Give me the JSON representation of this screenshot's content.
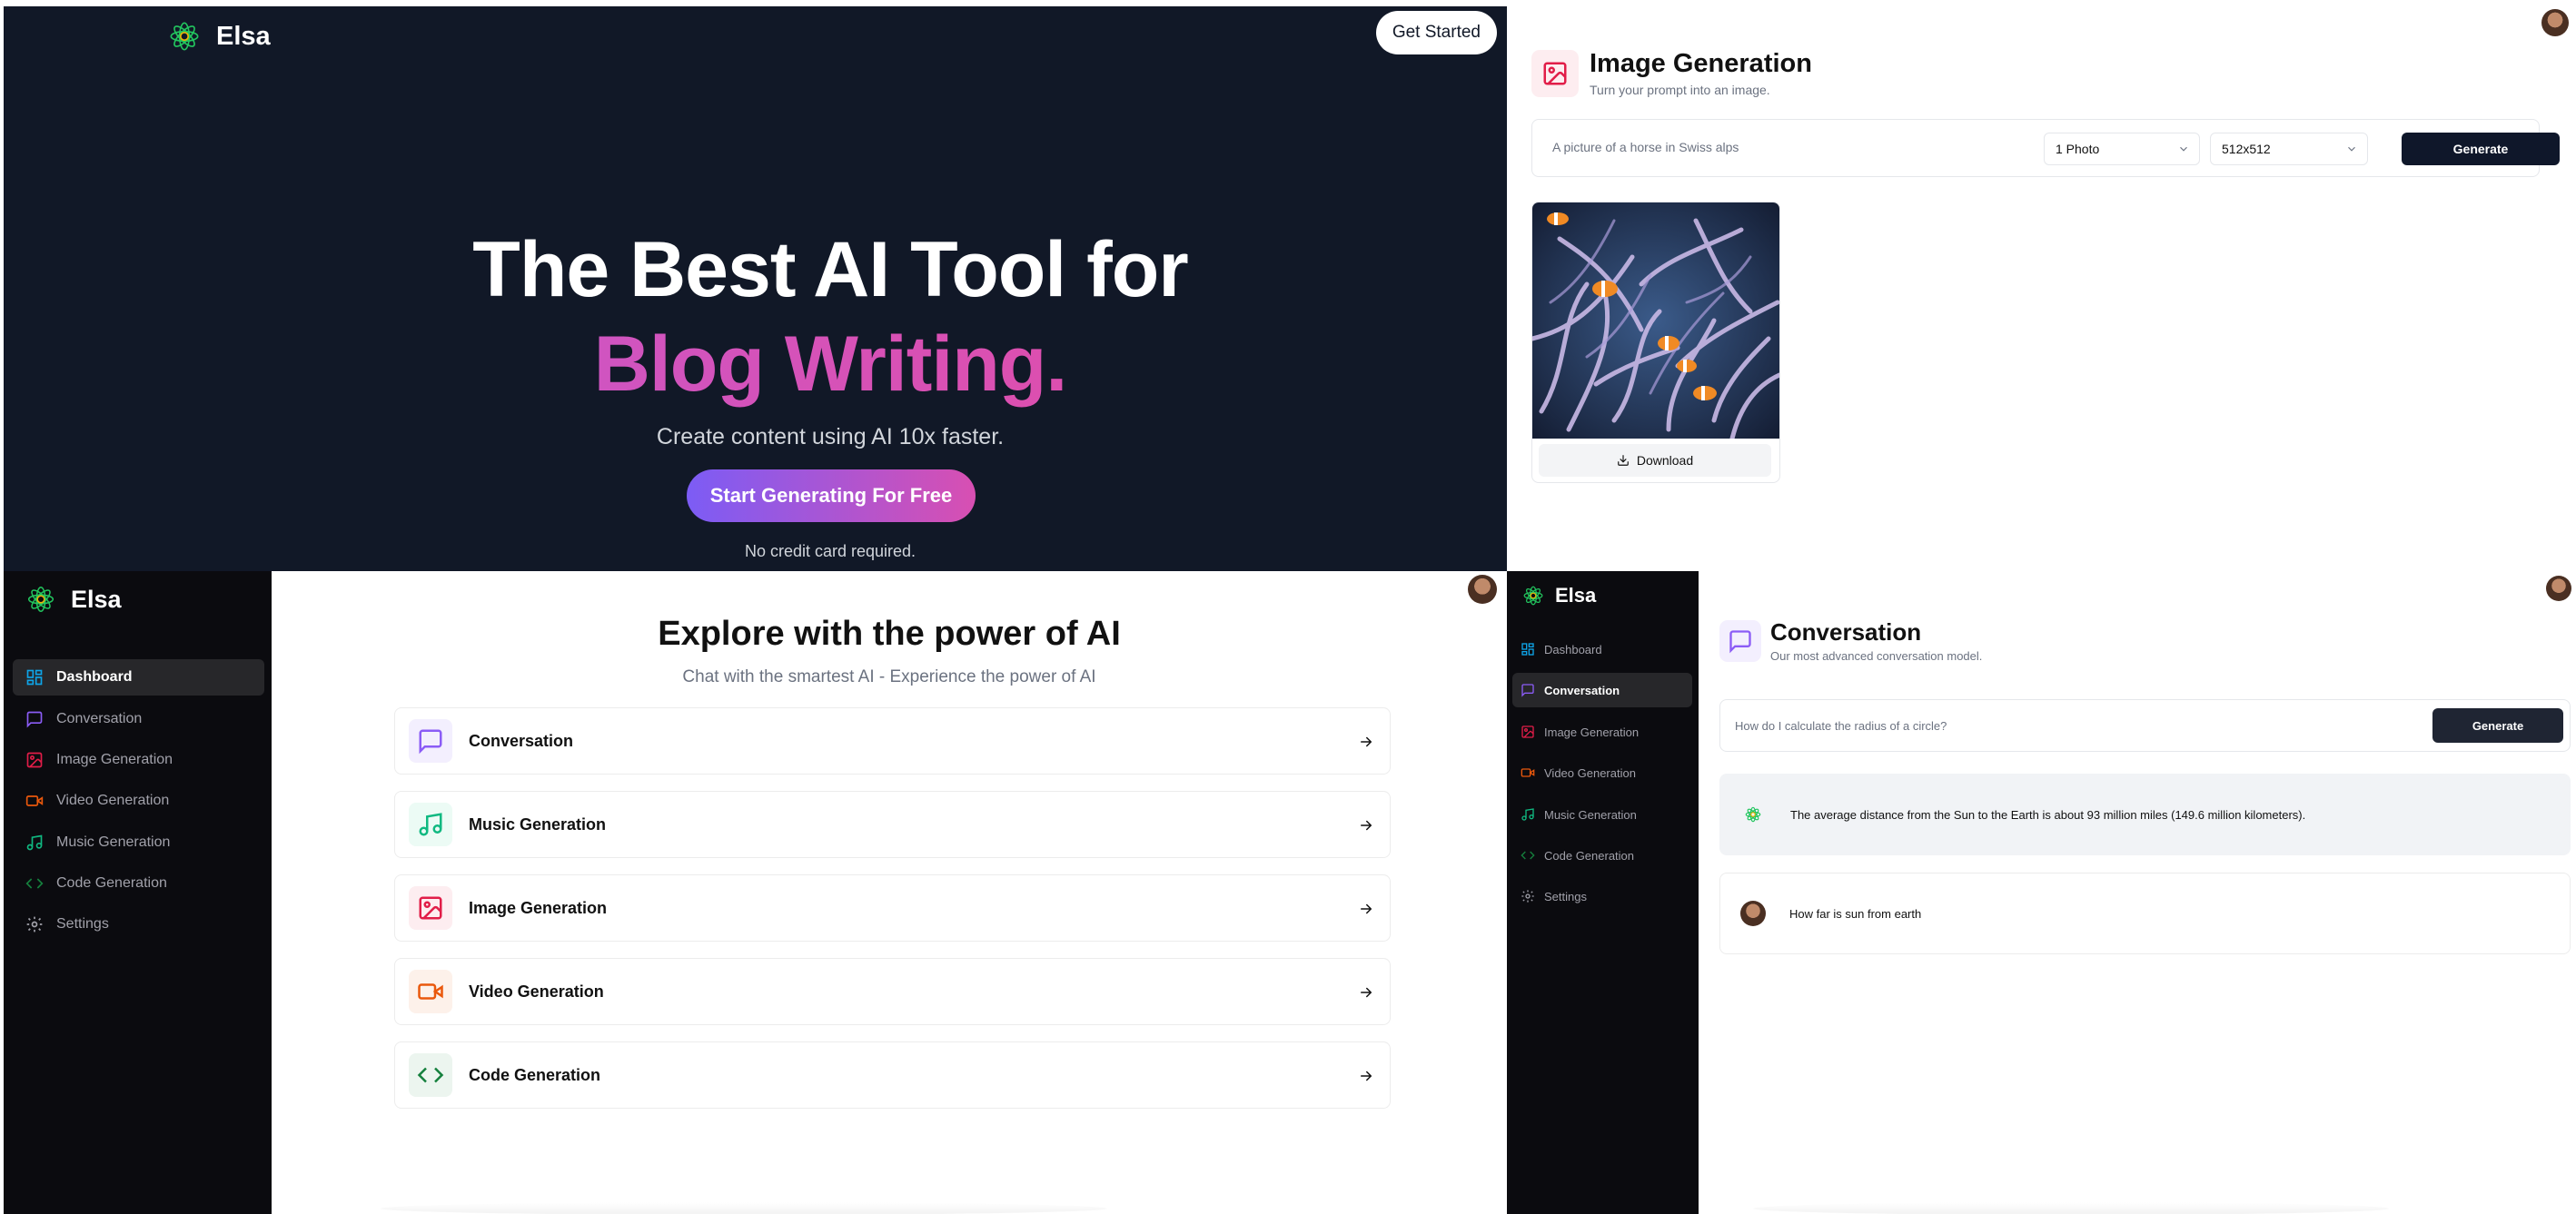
{
  "landing": {
    "brand_name": "Elsa",
    "get_started_label": "Get Started",
    "headline_line1": "The Best AI Tool for",
    "headline_line2": "Blog Writing.",
    "subheadline": "Create content using AI 10x faster.",
    "cta_label": "Start Generating For Free",
    "note": "No credit card required."
  },
  "image_generation": {
    "title": "Image Generation",
    "description": "Turn your prompt into an image.",
    "prompt_value": "A picture of a horse in Swiss alps",
    "amount_selected": "1 Photo",
    "resolution_selected": "512x512",
    "generate_label": "Generate",
    "download_label": "Download"
  },
  "sidebar": {
    "brand_name": "Elsa",
    "items": [
      {
        "label": "Dashboard",
        "icon": "layout-dashboard-icon",
        "color": "#0ea5e9"
      },
      {
        "label": "Conversation",
        "icon": "message-square-icon",
        "color": "#8b5cf6"
      },
      {
        "label": "Image Generation",
        "icon": "image-icon",
        "color": "#e11d48"
      },
      {
        "label": "Video Generation",
        "icon": "video-icon",
        "color": "#ea580c"
      },
      {
        "label": "Music Generation",
        "icon": "music-icon",
        "color": "#10b981"
      },
      {
        "label": "Code Generation",
        "icon": "code-icon",
        "color": "#15803d"
      },
      {
        "label": "Settings",
        "icon": "settings-icon",
        "color": "#a1a1aa"
      }
    ]
  },
  "dashboard": {
    "title": "Explore with the power of AI",
    "subtitle": "Chat with the smartest AI - Experience the power of AI",
    "tools": [
      {
        "label": "Conversation",
        "icon": "message-square-icon",
        "color": "#8b5cf6",
        "bg": "#f3effe"
      },
      {
        "label": "Music Generation",
        "icon": "music-icon",
        "color": "#10b981",
        "bg": "#ecfbf5"
      },
      {
        "label": "Image Generation",
        "icon": "image-icon",
        "color": "#e11d48",
        "bg": "#fdedf0"
      },
      {
        "label": "Video Generation",
        "icon": "video-icon",
        "color": "#ea580c",
        "bg": "#fdf1ea"
      },
      {
        "label": "Code Generation",
        "icon": "code-icon",
        "color": "#15803d",
        "bg": "#ecf5ef"
      }
    ]
  },
  "conversation": {
    "title": "Conversation",
    "description": "Our most advanced conversation model.",
    "prompt_placeholder": "How do I calculate the radius of a circle?",
    "generate_label": "Generate",
    "messages": [
      {
        "role": "assistant",
        "text": "The average distance from the Sun to the Earth is about 93 million miles (149.6 million kilometers)."
      },
      {
        "role": "user",
        "text": "How far is sun from earth"
      }
    ]
  }
}
